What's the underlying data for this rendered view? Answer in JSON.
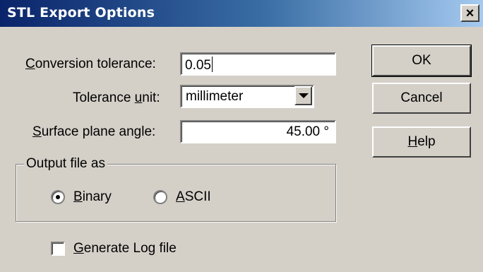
{
  "window": {
    "title": "STL Export Options",
    "close_label": "×"
  },
  "form": {
    "conversion_tolerance": {
      "label": "Conversion tolerance:",
      "value": "0.05"
    },
    "tolerance_unit": {
      "label": "Tolerance unit:",
      "value": "millimeter"
    },
    "surface_plane_angle": {
      "label": "Surface plane angle:",
      "value": "45.00 °"
    }
  },
  "output_group": {
    "legend": "Output file as",
    "options": [
      {
        "label": "Binary",
        "selected": true
      },
      {
        "label": "ASCII",
        "selected": false
      }
    ]
  },
  "log_checkbox": {
    "label": "Generate Log file",
    "checked": false
  },
  "buttons": {
    "ok": "OK",
    "cancel": "Cancel",
    "help": "Help"
  }
}
